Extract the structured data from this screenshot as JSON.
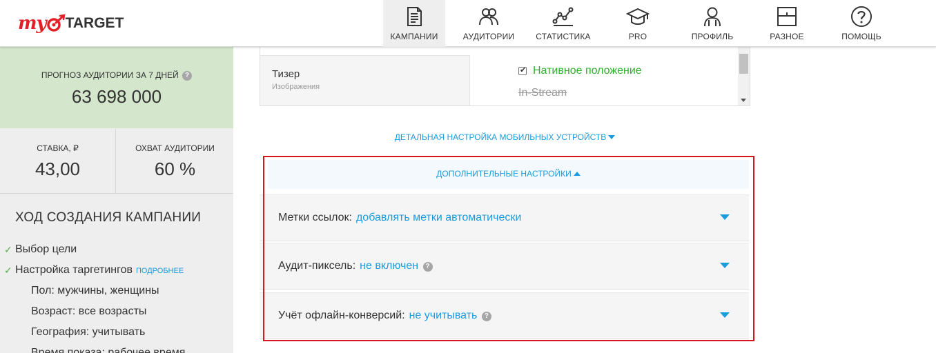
{
  "logo": {
    "my": "my",
    "target": "TARGET"
  },
  "nav": [
    {
      "label": "КАМПАНИИ",
      "icon": "campaigns-icon",
      "active": true
    },
    {
      "label": "АУДИТОРИИ",
      "icon": "audiences-icon"
    },
    {
      "label": "СТАТИСТИКА",
      "icon": "statistics-icon"
    },
    {
      "label": "PRO",
      "icon": "graduation-cap-icon"
    },
    {
      "label": "ПРОФИЛЬ",
      "icon": "profile-icon"
    },
    {
      "label": "РАЗНОЕ",
      "icon": "misc-icon"
    },
    {
      "label": "ПОМОЩЬ",
      "icon": "help-icon"
    }
  ],
  "sidebar": {
    "forecast_caption": "ПРОГНОЗ АУДИТОРИИ ЗА 7 ДНЕЙ",
    "forecast_value": "63 698 000",
    "rate_caption": "СТАВКА, ₽",
    "rate_value": "43,00",
    "reach_caption": "ОХВАТ АУДИТОРИИ",
    "reach_value": "60 %",
    "progress_title": "ХОД СОЗДАНИЯ КАМПАНИИ",
    "steps": [
      {
        "label": "Выбор цели"
      },
      {
        "label": "Настройка таргетингов",
        "more": "ПОДРОБНЕЕ"
      }
    ],
    "targeting": [
      "Пол: мужчины, женщины",
      "Возраст: все возрасты",
      "География: учитывать",
      "Время показа: рабочее время"
    ]
  },
  "ad_format": {
    "name": "Тизер",
    "description": "Изображения",
    "options": [
      {
        "label": "Нативное положение",
        "checked": true
      },
      {
        "label": "In-Stream",
        "disabled": true
      }
    ]
  },
  "detail_link": "ДЕТАЛЬНАЯ НАСТРОЙКА МОБИЛЬНЫХ УСТРОЙСТВ",
  "extra": {
    "header": "ДОПОЛНИТЕЛЬНЫЕ НАСТРОЙКИ",
    "settings": [
      {
        "label": "Метки ссылок:",
        "value": "добавлять метки автоматически"
      },
      {
        "label": "Аудит-пиксель:",
        "value": "не включен",
        "help": true
      },
      {
        "label": "Учёт офлайн-конверсий:",
        "value": "не учитывать",
        "help": true
      }
    ]
  },
  "colors": {
    "accent": "#1a9bdc",
    "forecast_bg": "#d4e6cc",
    "sidebar_bg": "#eeeeee",
    "highlight": "#d9141c",
    "green": "#2db12c",
    "brand_red": "#e21f26"
  }
}
